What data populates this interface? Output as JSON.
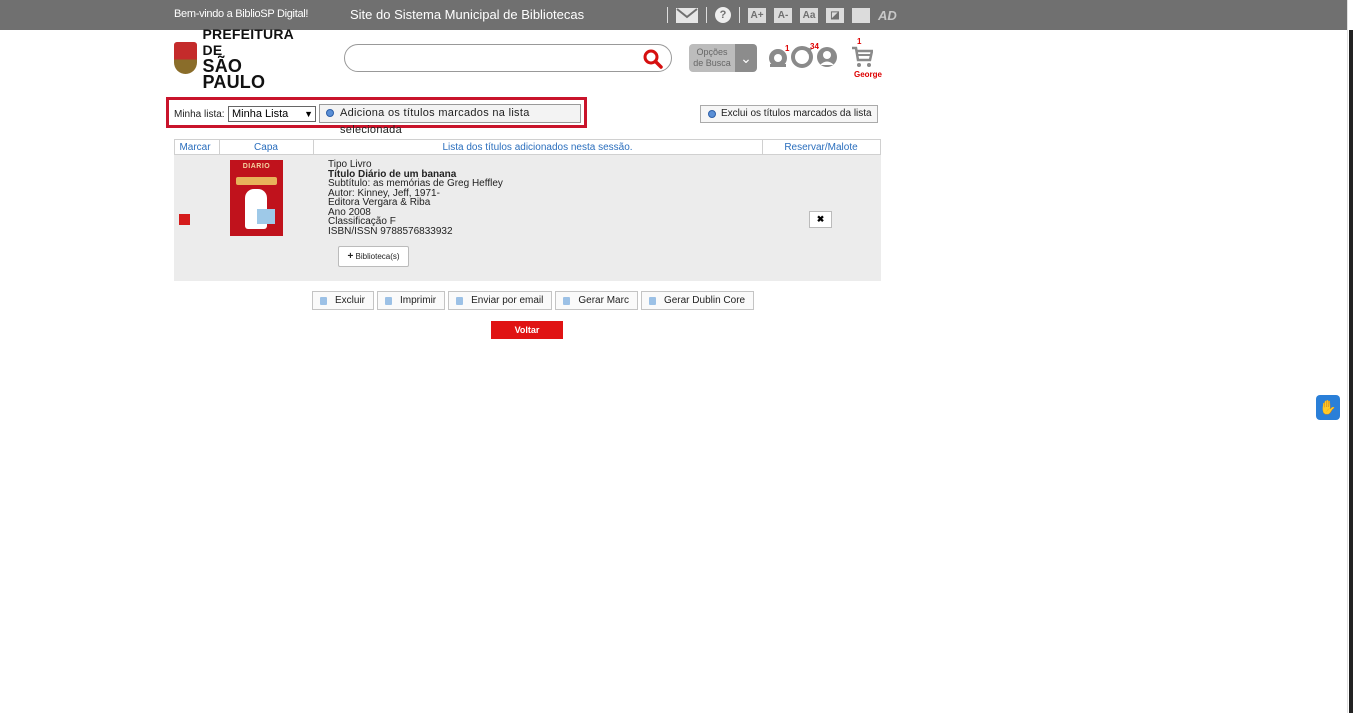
{
  "topbar": {
    "welcome": "Bem-vindo a BiblioSP Digital!",
    "site_title": "Site do Sistema Municipal de Bibliotecas",
    "icons": [
      "mail-icon",
      "help-icon",
      "font-increase-icon",
      "font-decrease-icon",
      "font-reset-icon",
      "contrast-icon",
      "contrast-alt-icon",
      "audio-description-icon"
    ],
    "font_labels": [
      "A+",
      "A-",
      "Aa"
    ],
    "ad_label": "AD"
  },
  "header": {
    "logo_line1": "PREFEITURA DE",
    "logo_line2": "SÃO PAULO",
    "search_value": "",
    "options_label_1": "Opções",
    "options_label_2": "de Busca",
    "badges": {
      "reservations": "1",
      "loans": "34",
      "cart": "1"
    },
    "user_name": "George"
  },
  "list_bar": {
    "label": "Minha lista:",
    "selected_list": "Minha Lista",
    "add_button": "Adiciona os títulos marcados na lista selecionada",
    "remove_button": "Exclui os títulos marcados da lista"
  },
  "table": {
    "headers": [
      "Marcar",
      "Capa",
      "Lista dos títulos adicionados nesta sessão.",
      "Reservar/Malote"
    ],
    "row": {
      "cover_title": "DIARIO",
      "tipo": "Tipo Livro",
      "titulo_label": "Título",
      "titulo": "Diário de um banana",
      "subtitulo": "Subtítulo: as memórias de Greg Heffley",
      "autor": "Autor: Kinney, Jeff, 1971-",
      "editora": "Editora Vergara & Riba",
      "ano": "Ano 2008",
      "classificacao": "Classificação F",
      "isbn": "ISBN/ISSN 9788576833932",
      "biblioteca_button": "Biblioteca(s)",
      "reserve_symbol": "✖"
    }
  },
  "actions": {
    "excluir": "Excluir",
    "imprimir": "Imprimir",
    "enviar": "Enviar por email",
    "marc": "Gerar Marc",
    "dublin": "Gerar Dublin Core",
    "voltar": "Voltar"
  },
  "colors": {
    "topbar": "#707070",
    "accent_red": "#e01313",
    "header_blue": "#2a6ebd",
    "highlight_border": "#c9142b"
  }
}
